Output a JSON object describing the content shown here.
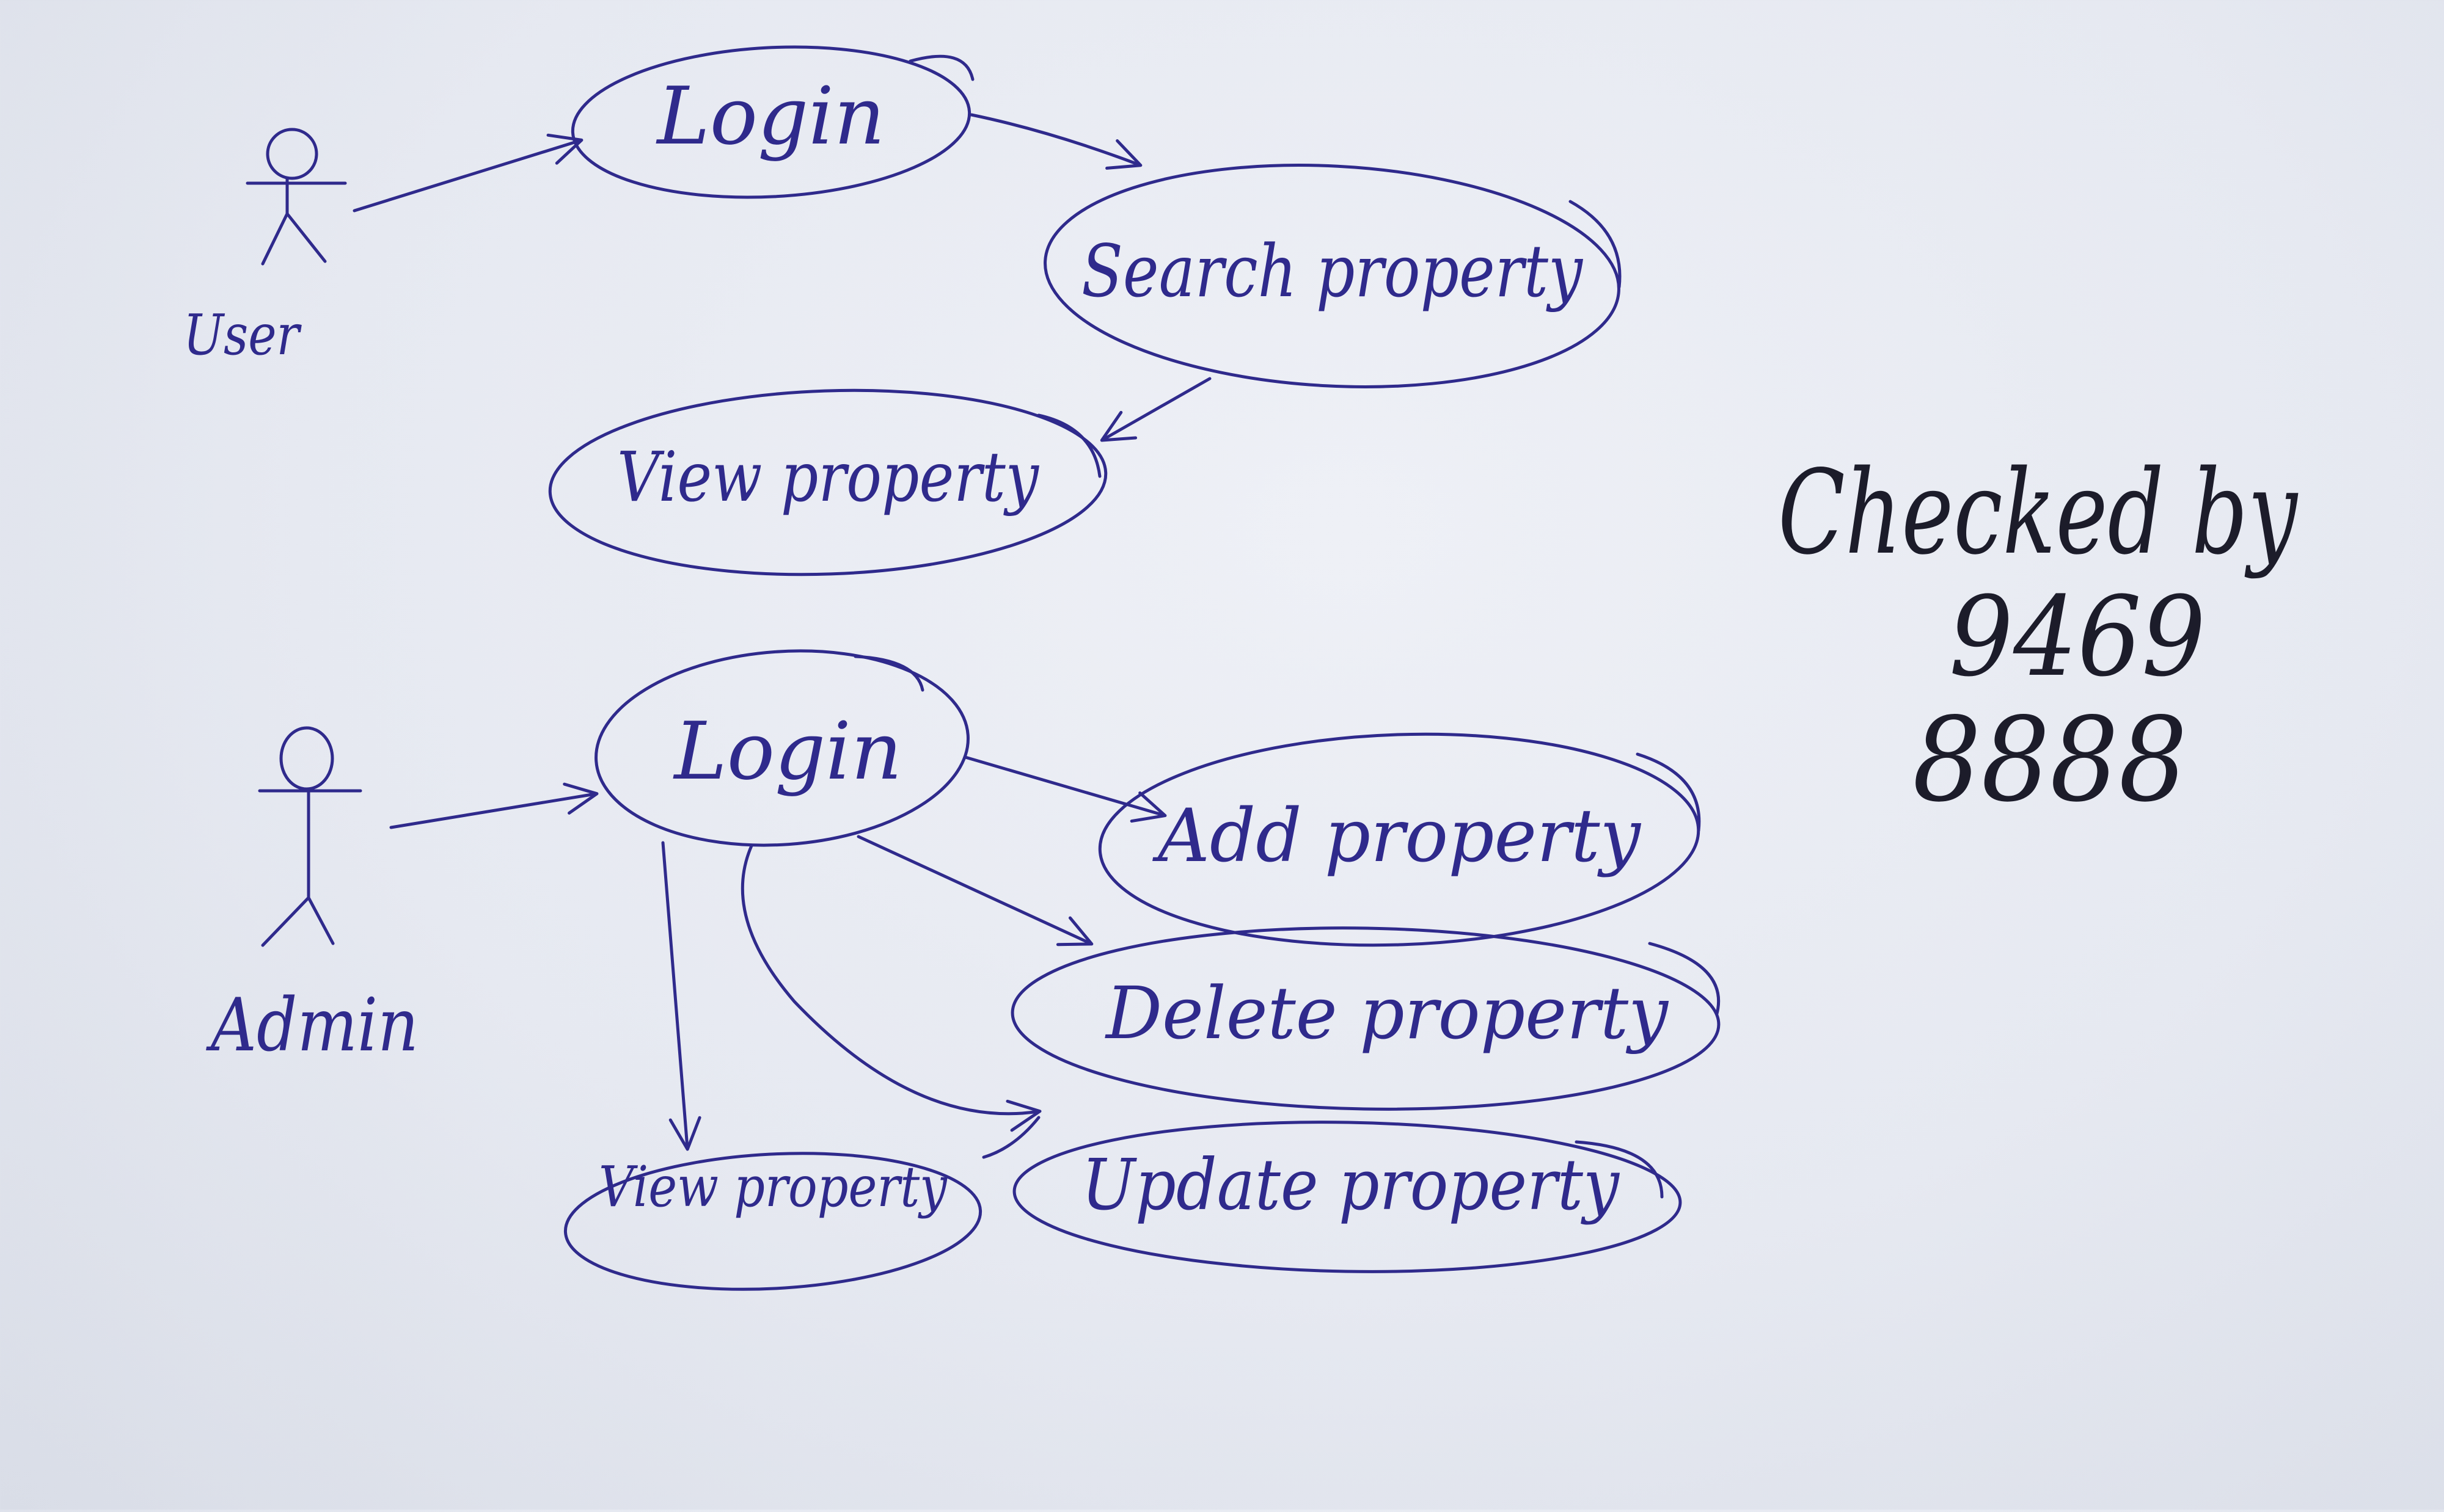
{
  "ink_color": "#2f2a8c",
  "note_color": "#1c1c2a",
  "actors": {
    "user": {
      "label": "User",
      "icon": "stick-figure-icon"
    },
    "admin": {
      "label": "Admin",
      "icon": "stick-figure-icon"
    }
  },
  "use_cases": {
    "user_login": "Login",
    "search_property": "Search property",
    "user_view_property": "View property",
    "admin_login": "Login",
    "add_property": "Add property",
    "delete_property": "Delete property",
    "update_property": "Update property",
    "admin_view_property": "View property"
  },
  "checked_note": {
    "line1": "Checked by",
    "line2": "9469",
    "line3": "8888"
  }
}
